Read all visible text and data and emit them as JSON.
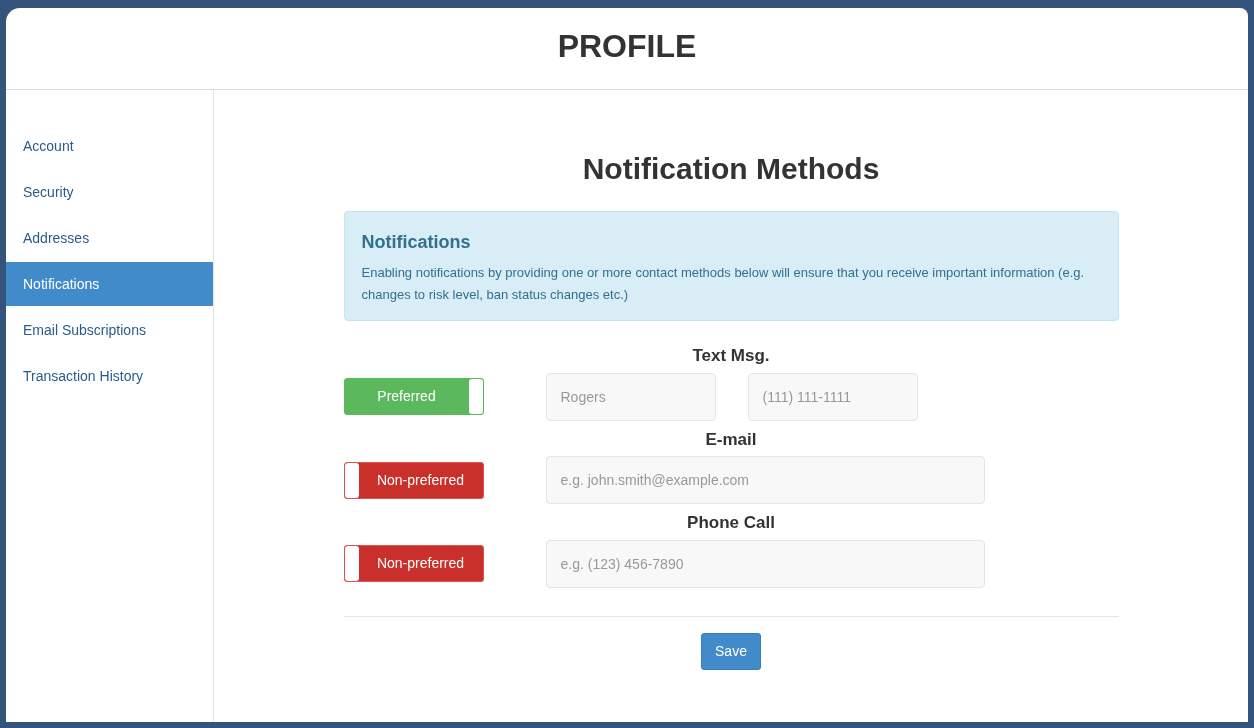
{
  "header": {
    "title": "PROFILE"
  },
  "sidebar": {
    "items": [
      {
        "label": "Account",
        "selected": false
      },
      {
        "label": "Security",
        "selected": false
      },
      {
        "label": "Addresses",
        "selected": false
      },
      {
        "label": "Notifications",
        "selected": true
      },
      {
        "label": "Email Subscriptions",
        "selected": false
      },
      {
        "label": "Transaction History",
        "selected": false
      }
    ]
  },
  "main": {
    "title": "Notification Methods",
    "alert": {
      "title": "Notifications",
      "text": "Enabling notifications by providing one or more contact methods below will ensure that you receive important information (e.g. changes to risk level, ban status changes etc.)"
    },
    "methods": [
      {
        "title": "Text Msg.",
        "toggle": {
          "label": "Preferred",
          "on": true
        },
        "fields": [
          {
            "placeholder": "Rogers"
          },
          {
            "placeholder": "(111) 111-1111"
          }
        ]
      },
      {
        "title": "E-mail",
        "toggle": {
          "label": "Non-preferred",
          "on": false
        },
        "fields": [
          {
            "placeholder": "e.g. john.smith@example.com"
          }
        ]
      },
      {
        "title": "Phone Call",
        "toggle": {
          "label": "Non-preferred",
          "on": false
        },
        "fields": [
          {
            "placeholder": "e.g. (123) 456-7890"
          }
        ]
      }
    ],
    "save_button": "Save"
  }
}
